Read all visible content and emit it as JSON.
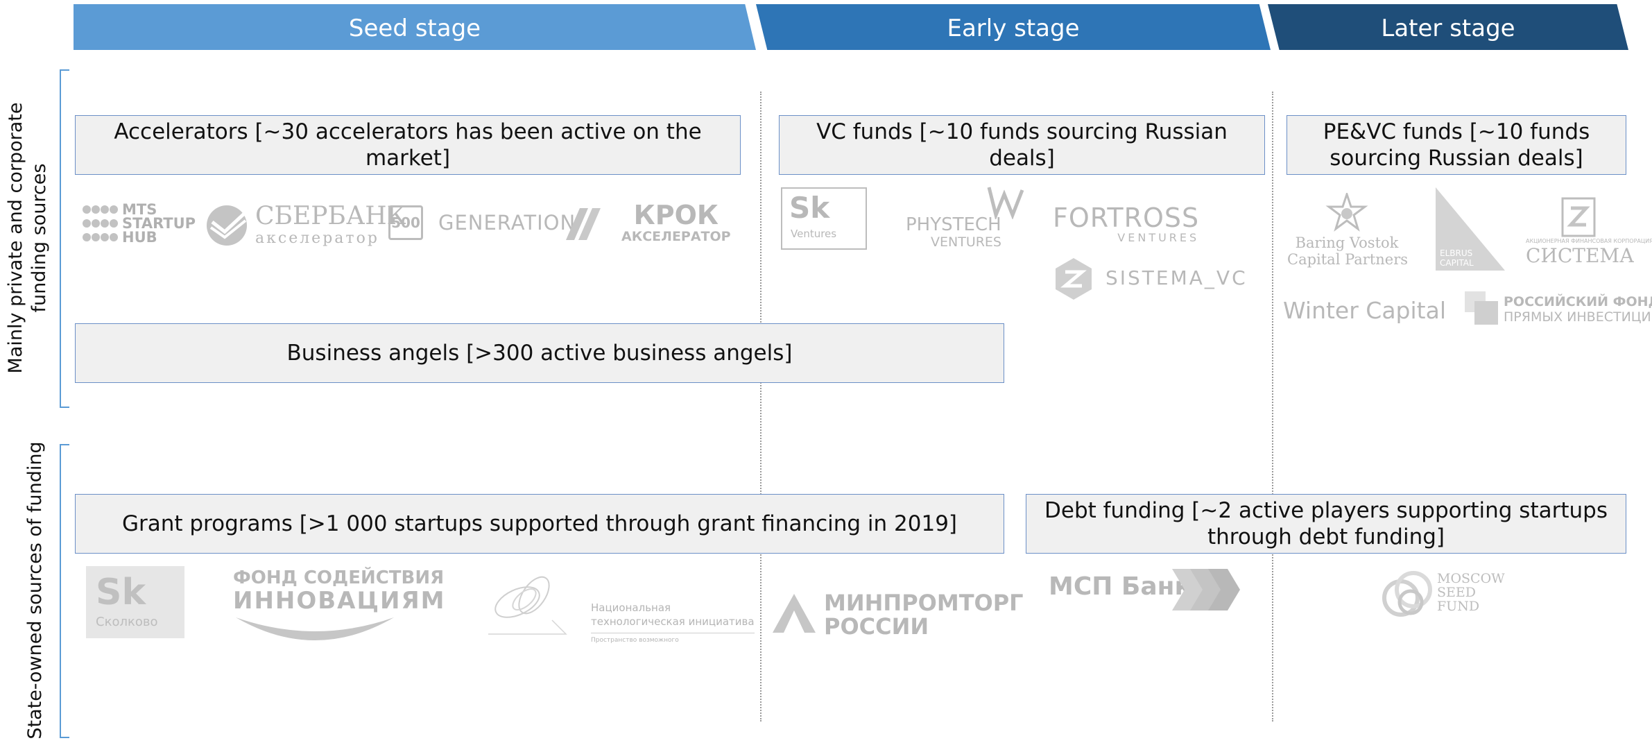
{
  "stages": {
    "seed": "Seed stage",
    "early": "Early stage",
    "later": "Later stage"
  },
  "sections": {
    "private": "Mainly private and corporate funding sources",
    "state": "State-owned sources of funding"
  },
  "boxes": {
    "accelerators": "Accelerators [~30 accelerators has been active on the market]",
    "vc_funds": "VC funds [~10 funds sourcing Russian deals]",
    "pe_vc_funds": "PE&VC funds [~10 funds sourcing Russian deals]",
    "business_angels": "Business angels [>300 active business angels]",
    "grant_programs": "Grant programs [>1 000 startups supported through grant financing in 2019]",
    "debt_funding": "Debt funding [~2 active players supporting startups through debt funding]"
  },
  "logos": {
    "mts_1": "MTS",
    "mts_2": "STARTUP",
    "mts_3": "HUB",
    "sberbank_1": "СБЕРБАНК",
    "sberbank_2": "акселератор",
    "five_hundred": "500",
    "generation": "GENERATION",
    "krok_1": "КРОК",
    "krok_2": "АКСЕЛЕРАТОР",
    "sk_ventures_1": "Sk",
    "sk_ventures_2": "Ventures",
    "phystech_1": "PHYSTECH",
    "phystech_2": "VENTURES",
    "fortross_1": "FORTROSS",
    "fortross_2": "VENTURES",
    "sistema_vc": "SISTEMA_VC",
    "baring_1": "Baring Vostok",
    "baring_2": "Capital Partners",
    "elbrus_1": "ELBRUS",
    "elbrus_2": "CAPITAL",
    "sistema_1": "АКЦИОНЕРНАЯ ФИНАНСОВАЯ КОРПОРАЦИЯ",
    "sistema_2": "СИСТЕМА",
    "winter_capital": "Winter Capital",
    "rdif_1": "РОССИЙСКИЙ ФОНД",
    "rdif_2": "ПРЯМЫХ ИНВЕСТИЦИЙ",
    "skolkovo_1": "Sk",
    "skolkovo_2": "Сколково",
    "fond_1": "ФОНД СОДЕЙСТВИЯ",
    "fond_2": "ИННОВАЦИЯМ",
    "nti_1": "Национальная",
    "nti_2": "технологическая инициатива",
    "nti_3": "Пространство возможного",
    "minprom_1": "МИНПРОМТОРГ",
    "minprom_2": "РОССИИ",
    "msp_bank": "МСП Банк",
    "msf_1": "MOSCOW",
    "msf_2": "SEED",
    "msf_3": "FUND"
  },
  "colors": {
    "seed": "#5b9bd5",
    "early": "#2e75b6",
    "later": "#1f4e79",
    "box_border": "#6b8fc7",
    "box_fill": "#f0f0f0",
    "logo_grey": "#b8b8b8"
  }
}
